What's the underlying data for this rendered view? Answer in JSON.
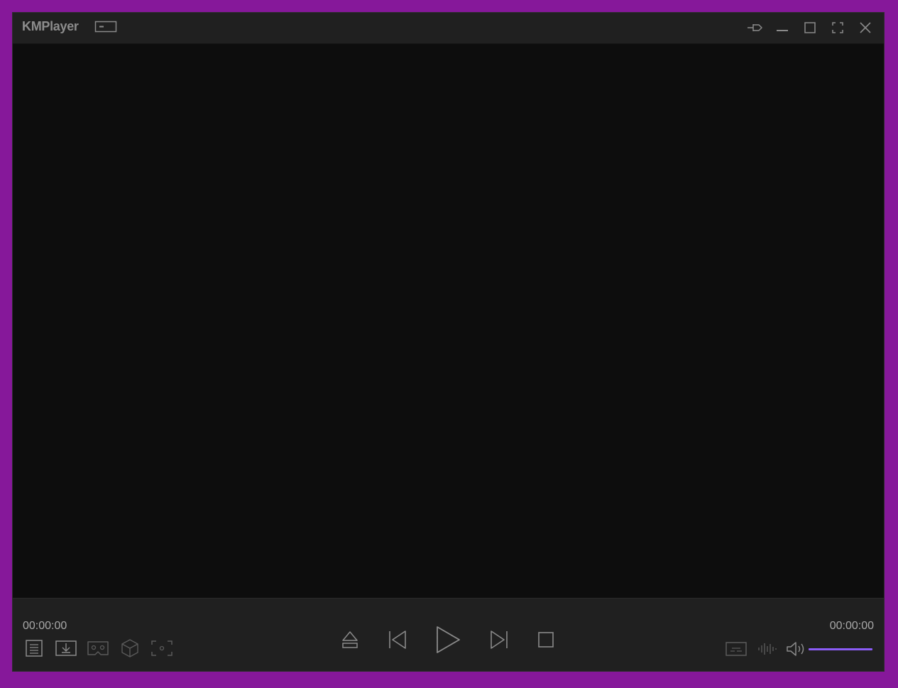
{
  "app": {
    "title": "KMPlayer"
  },
  "titlebar": {
    "buttons": [
      {
        "name": "pin-button",
        "icon": "pin-icon"
      },
      {
        "name": "minimize-button",
        "icon": "minimize-icon"
      },
      {
        "name": "maximize-button",
        "icon": "maximize-icon"
      },
      {
        "name": "fullscreen-button",
        "icon": "fullscreen-icon"
      },
      {
        "name": "close-button",
        "icon": "close-icon"
      }
    ]
  },
  "playback": {
    "current_time": "00:00:00",
    "total_time": "00:00:00",
    "volume_fraction": 1.0
  },
  "left_tools": [
    "playlist-icon",
    "download-icon",
    "vr-headset-icon",
    "3d-cube-icon",
    "capture-icon"
  ],
  "center_controls": [
    "eject-icon",
    "previous-icon",
    "play-icon",
    "next-icon",
    "stop-icon"
  ],
  "right_tools": [
    "subtitle-icon",
    "audio-wave-icon",
    "volume-icon"
  ],
  "colors": {
    "background": "#86189a",
    "accent": "#8b5cf6",
    "icon": "#8a8a8a",
    "icon_dim": "#5a5a5a"
  }
}
